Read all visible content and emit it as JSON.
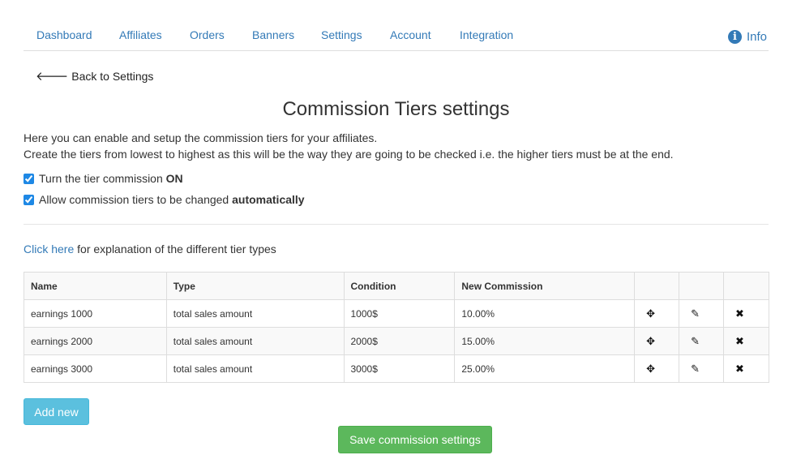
{
  "nav": {
    "items": [
      "Dashboard",
      "Affiliates",
      "Orders",
      "Banners",
      "Settings",
      "Account",
      "Integration"
    ],
    "info_label": "Info"
  },
  "back_link": "Back to Settings",
  "page_title": "Commission Tiers settings",
  "description": {
    "line1": "Here you can enable and setup the commission tiers for your affiliates.",
    "line2": "Create the tiers from lowest to highest as this will be the way they are going to be checked i.e. the higher tiers must be at the end."
  },
  "options": [
    {
      "text": "Turn the tier commission ",
      "strong": "ON",
      "checked": true
    },
    {
      "text": "Allow commission tiers to be changed ",
      "strong": "automatically",
      "checked": true
    }
  ],
  "explanation": {
    "link": "Click here",
    "text": " for explanation of the different tier types"
  },
  "table": {
    "headers": [
      "Name",
      "Type",
      "Condition",
      "New Commission"
    ],
    "rows": [
      [
        "earnings 1000",
        "total sales amount",
        "1000$",
        "10.00%"
      ],
      [
        "earnings 2000",
        "total sales amount",
        "2000$",
        "15.00%"
      ],
      [
        "earnings 3000",
        "total sales amount",
        "3000$",
        "25.00%"
      ]
    ],
    "row_actions": [
      "move-icon",
      "edit-pencil-icon",
      "delete-x-icon"
    ]
  },
  "buttons": {
    "add_new": "Add new",
    "save": "Save commission settings"
  },
  "colors": {
    "link": "#337ab7",
    "add_button": "#5bc0de",
    "save_button": "#5cb85c"
  }
}
